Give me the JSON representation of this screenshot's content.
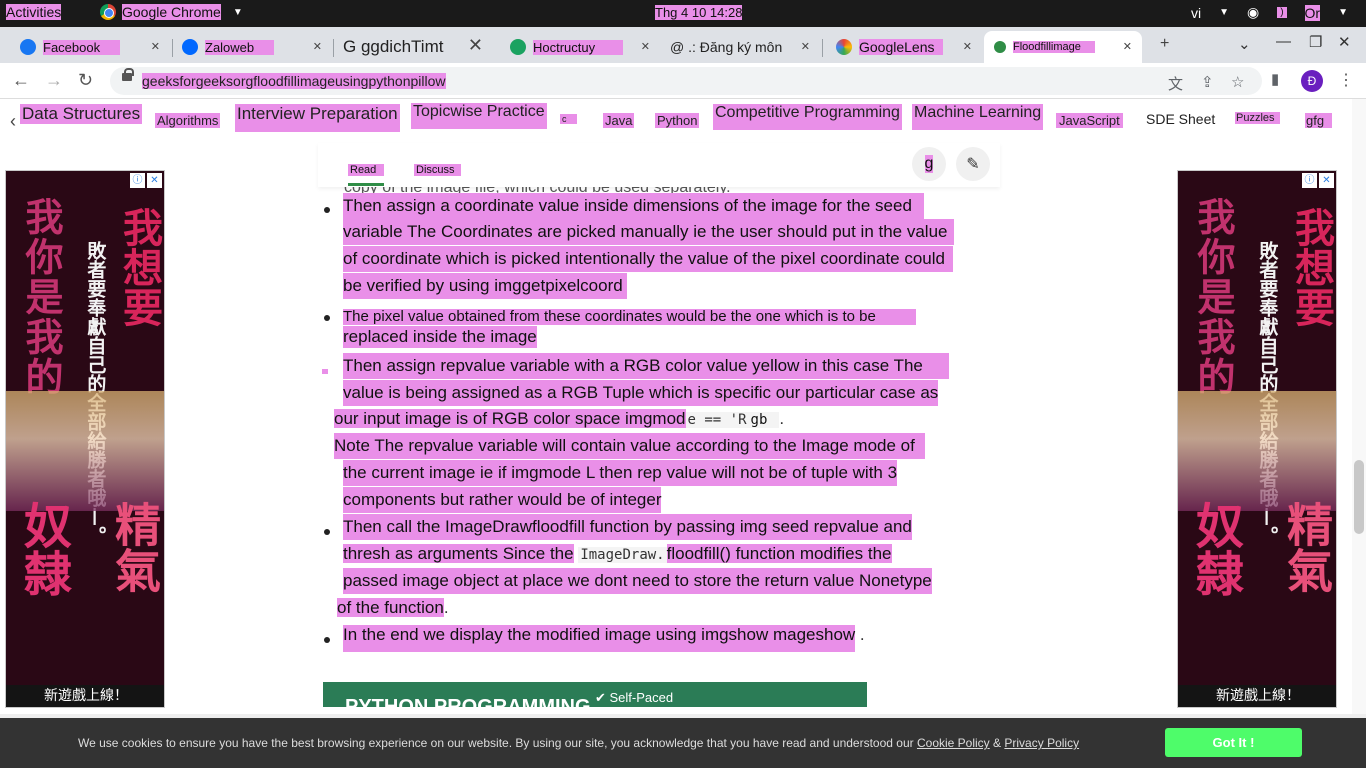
{
  "topbar": {
    "activities": "Activities",
    "app_name": "Google Chrome",
    "clock": "Thg 4 10  14:28",
    "lang": "vi",
    "power": "Or"
  },
  "tabs": [
    {
      "title": "Facebook",
      "color": "#1877f2"
    },
    {
      "title": "Zaloweb",
      "color": "#0068ff"
    },
    {
      "title": "G ggdichTimt",
      "color": "#4285f4"
    },
    {
      "title": "Hoctructuy",
      "color": "#1aa260"
    },
    {
      "title": "@ .: Đăng ký môn",
      "color": "#888888"
    },
    {
      "title": "GoogleLens",
      "color": "#ea4335"
    },
    {
      "title": "Floodfillimage",
      "color": "#2f8d46"
    }
  ],
  "url": "geeksforgeeksorgfloodfillimageusingpythonpillow",
  "profile_letter": "Đ",
  "nav": [
    "Data Structures",
    "Algorithms",
    "Interview Preparation",
    "Topicwise Practice",
    "c",
    "Java",
    "Python",
    "Competitive Programming",
    "Machine Learning",
    "JavaScript",
    "SDE Sheet",
    "Puzzles",
    "gfg"
  ],
  "article_tabs": {
    "read": "Read",
    "discuss": "Discuss",
    "code_icon": "g"
  },
  "ad": {
    "left_column": "我你是我的",
    "right_column": "我想要",
    "small_column": "敗者要奉獻自己的全部給勝者哦—。",
    "bottom_left": "奴隸",
    "bottom_right": "精氣",
    "banner": "新遊戲上線！"
  },
  "body": {
    "cut_line": "copy of the image file, which could be used separately.",
    "b1": [
      "Then assign a coordinate value inside dimensions of the image for the seed",
      "variable The Coordinates are picked manually ie the user should put in the value",
      "of coordinate which is picked intentionally the value of the pixel coordinate could",
      "be verified by using imggetpixelcoord"
    ],
    "b2": [
      "The pixel value obtained from these coordinates would be the one which is to be",
      "replaced inside the image"
    ],
    "b3": [
      "Then assign repvalue variable with a RGB color value yellow in this case The",
      "value is being assigned as a RGB Tuple which is specific our particular case as",
      "our input image is of RGB color space imgmod",
      "e == 'R",
      "gb",
      "Note The repvalue variable will contain value according to the Image mode of",
      "the current image ie if imgmode L then rep value will not be of tuple with 3",
      "components but rather would be of integer"
    ],
    "b4": [
      "Then call the ImageDrawfloodfill function by passing img seed repvalue and",
      "thresh as arguments Since the",
      "ImageDraw.",
      "floodfill() function modifies the",
      "passed image object at place we dont need to store the return value Nonetype",
      "of the function"
    ],
    "b5": [
      "In the end we display the modified image using imgshow mageshow"
    ],
    "promo_title": "PYTHON PROGRAMMING",
    "promo_badge": "Self-Paced"
  },
  "cookie": {
    "message": "We use cookies to ensure you have the best browsing experience on our website. By using our site, you acknowledge that you have read and understood our",
    "policy": "Cookie Policy",
    "amp": "&",
    "privacy": "Privacy Policy",
    "button": "Got It !"
  }
}
